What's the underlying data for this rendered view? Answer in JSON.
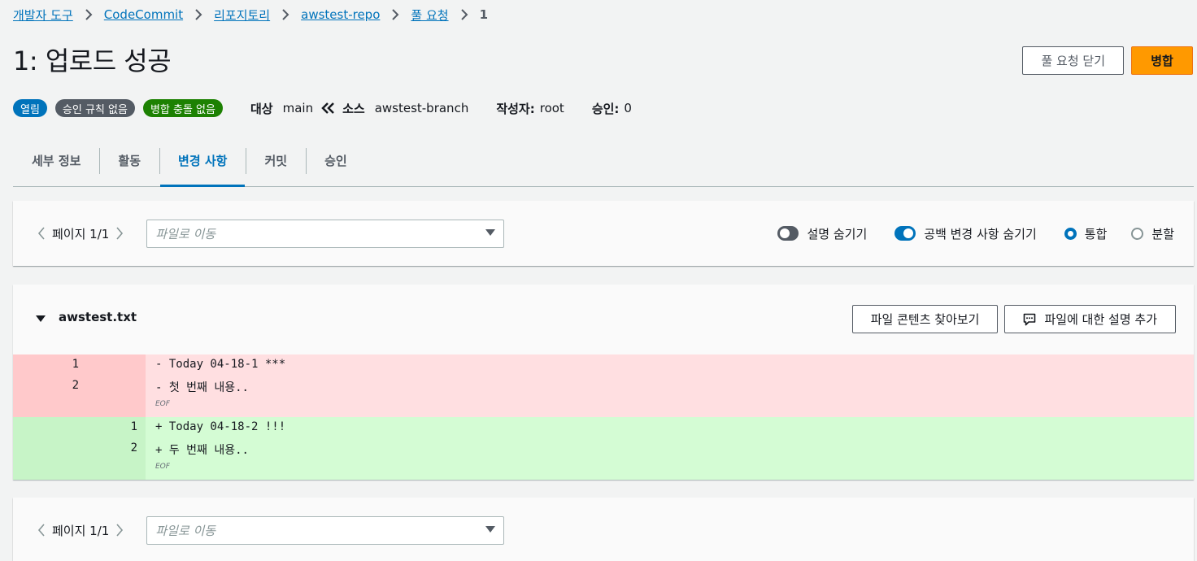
{
  "breadcrumb": {
    "items": [
      "개발자 도구",
      "CodeCommit",
      "리포지토리",
      "awstest-repo",
      "풀 요청"
    ],
    "current": "1"
  },
  "page": {
    "title": "1: 업로드 성공"
  },
  "actions": {
    "close_label": "풀 요청 닫기",
    "merge_label": "병합"
  },
  "status": {
    "badges": [
      "열림",
      "승인 규칙 없음",
      "병합 충돌 없음"
    ],
    "target_label": "대상",
    "target_value": "main",
    "source_label": "소스",
    "source_value": "awstest-branch",
    "author_label": "작성자:",
    "author_value": "root",
    "approval_label": "승인:",
    "approval_value": "0"
  },
  "tabs": [
    "세부 정보",
    "활동",
    "변경 사항",
    "커밋",
    "승인"
  ],
  "active_tab": "변경 사항",
  "toolbar": {
    "page_text": "페이지 1/1",
    "file_select_placeholder": "파일로 이동",
    "hide_comments_label": "설명 숨기기",
    "hide_comments_on": false,
    "hide_whitespace_label": "공백 변경 사항 숨기기",
    "hide_whitespace_on": true,
    "unified_label": "통합",
    "split_label": "분할",
    "view_mode": "unified"
  },
  "file": {
    "name": "awstest.txt",
    "browse_label": "파일 콘텐츠 찾아보기",
    "comment_label": "파일에 대한 설명 추가",
    "deleted_lines": [
      {
        "old": "1",
        "text": "- Today 04-18-1 ***"
      },
      {
        "old": "2",
        "text": "- 첫 번째 내용.."
      }
    ],
    "added_lines": [
      {
        "new": "1",
        "text": "+ Today 04-18-2 !!!"
      },
      {
        "new": "2",
        "text": "+ 두 번째 내용.."
      }
    ],
    "eof_marker": "EOF"
  },
  "colors": {
    "link": "#0073bb",
    "primary_button": "#ff9900",
    "badge_open": "#0073bb",
    "badge_rules": "#545b64",
    "badge_no_conflict": "#1d8102",
    "deleted_bg": "#ffdfe1",
    "added_bg": "#d4fcd4"
  }
}
